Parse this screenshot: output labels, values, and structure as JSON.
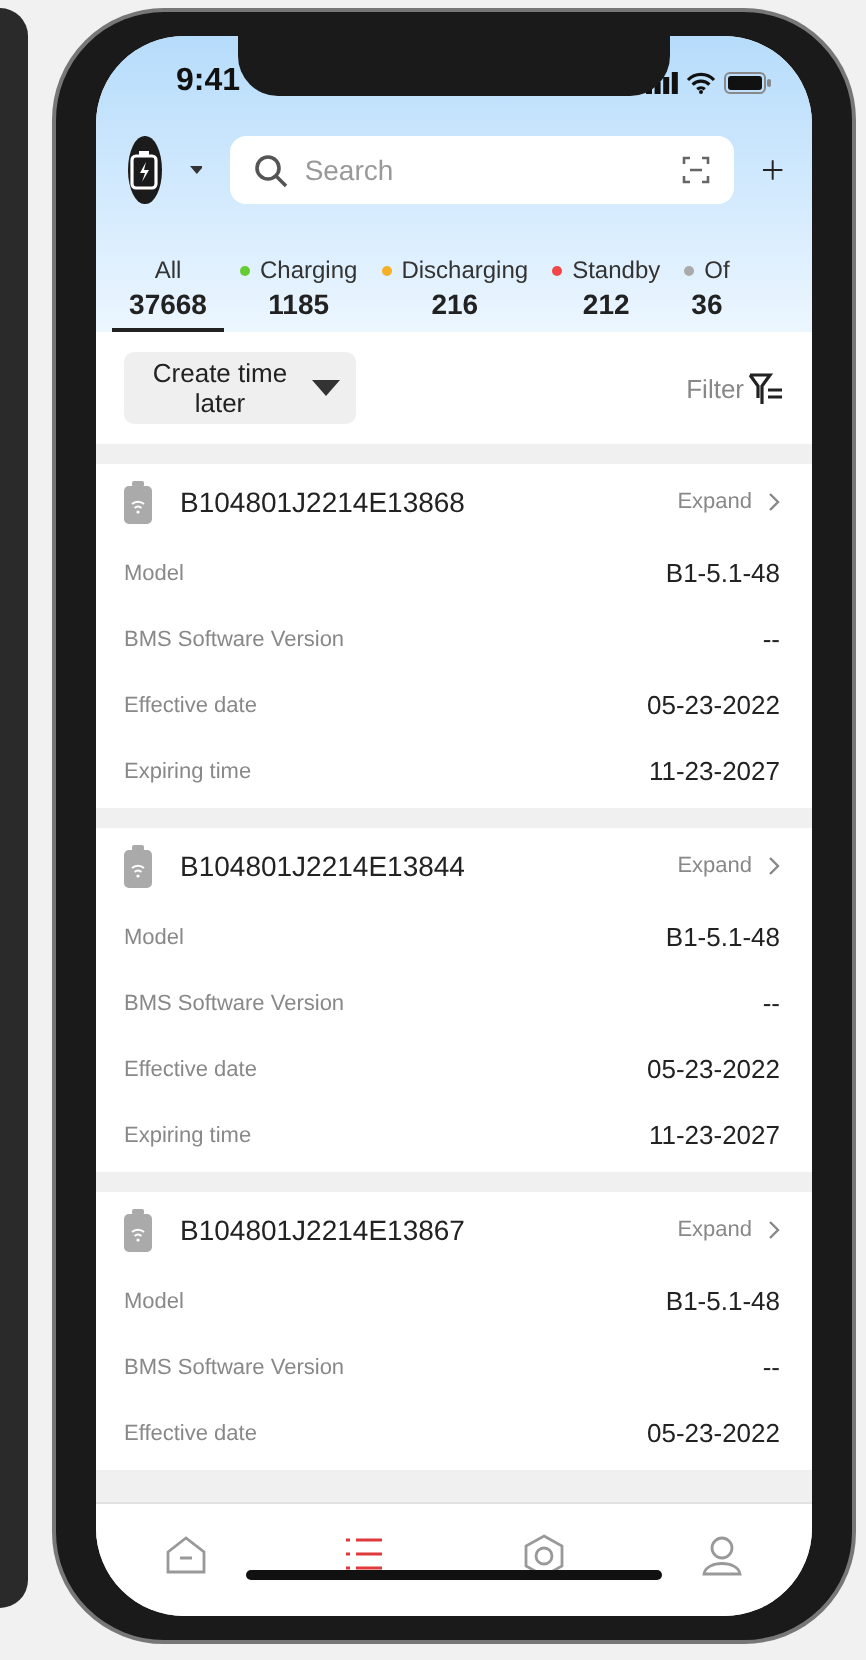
{
  "status_bar": {
    "time": "9:41"
  },
  "header": {
    "search": {
      "placeholder": "Search"
    }
  },
  "tabs": [
    {
      "label": "All",
      "count": "37668",
      "selected": true
    },
    {
      "label": "Charging",
      "count": "1185",
      "selected": false,
      "color": "#66cc33"
    },
    {
      "label": "Discharging",
      "count": "216",
      "selected": false,
      "color": "#f5b028"
    },
    {
      "label": "Standby",
      "count": "212",
      "selected": false,
      "color": "#f04848"
    },
    {
      "label": "Of",
      "count": "36",
      "selected": false,
      "color": "#aaaaaa"
    }
  ],
  "sort": {
    "label": "Create time later"
  },
  "filter": {
    "label": "Filter"
  },
  "devices": [
    {
      "id": "B104801J2214E13868",
      "action": "Expand",
      "fields": [
        {
          "label": "Model",
          "value": "B1-5.1-48"
        },
        {
          "label": "BMS Software Version",
          "value": "--"
        },
        {
          "label": "Effective date",
          "value": "05-23-2022"
        },
        {
          "label": "Expiring time",
          "value": "11-23-2027"
        }
      ]
    },
    {
      "id": "B104801J2214E13844",
      "action": "Expand",
      "fields": [
        {
          "label": "Model",
          "value": "B1-5.1-48"
        },
        {
          "label": "BMS Software Version",
          "value": "--"
        },
        {
          "label": "Effective date",
          "value": "05-23-2022"
        },
        {
          "label": "Expiring time",
          "value": "11-23-2027"
        }
      ]
    },
    {
      "id": "B104801J2214E13867",
      "action": "Expand",
      "fields": [
        {
          "label": "Model",
          "value": "B1-5.1-48"
        },
        {
          "label": "BMS Software Version",
          "value": "--"
        },
        {
          "label": "Effective date",
          "value": "05-23-2022"
        }
      ]
    }
  ],
  "bottom_nav": [
    {
      "kind": "home",
      "selected": false
    },
    {
      "kind": "list",
      "selected": true
    },
    {
      "kind": "shield",
      "selected": false
    },
    {
      "kind": "user",
      "selected": false
    }
  ]
}
